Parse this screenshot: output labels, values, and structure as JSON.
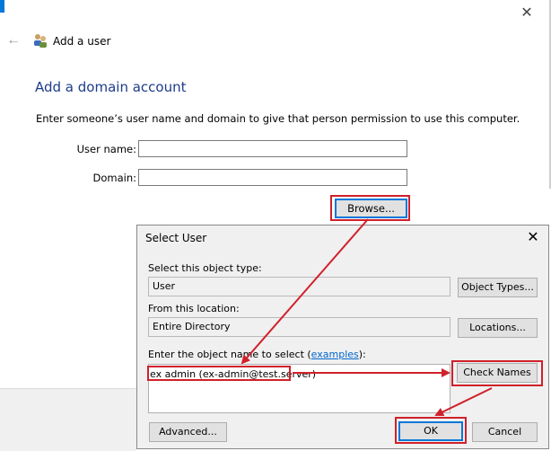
{
  "outer_window": {
    "title": "Add a user",
    "heading": "Add a domain account",
    "instructions": "Enter someone’s user name and domain to give that person permission to use this computer.",
    "user_name_label": "User name:",
    "user_name_value": "",
    "domain_label": "Domain:",
    "domain_value": "",
    "browse_label": "Browse..."
  },
  "dialog": {
    "title": "Select User",
    "object_type_label": "Select this object type:",
    "object_type_value": "User",
    "object_types_button": "Object Types...",
    "location_label": "From this location:",
    "location_value": "Entire Directory",
    "locations_button": "Locations...",
    "enter_label_prefix": "Enter the object name to select (",
    "examples_link": "examples",
    "enter_label_suffix": "):",
    "entered_name": "ex admin (ex-admin@test.server)",
    "check_names_button": "Check Names",
    "advanced_button": "Advanced...",
    "ok_button": "OK",
    "cancel_button": "Cancel"
  },
  "colors": {
    "highlight": "#d0202a",
    "accent": "#0078d7",
    "heading": "#1e3b8a",
    "link": "#0066cc"
  },
  "icons": [
    "close-icon",
    "back-arrow-icon",
    "users-icon"
  ]
}
